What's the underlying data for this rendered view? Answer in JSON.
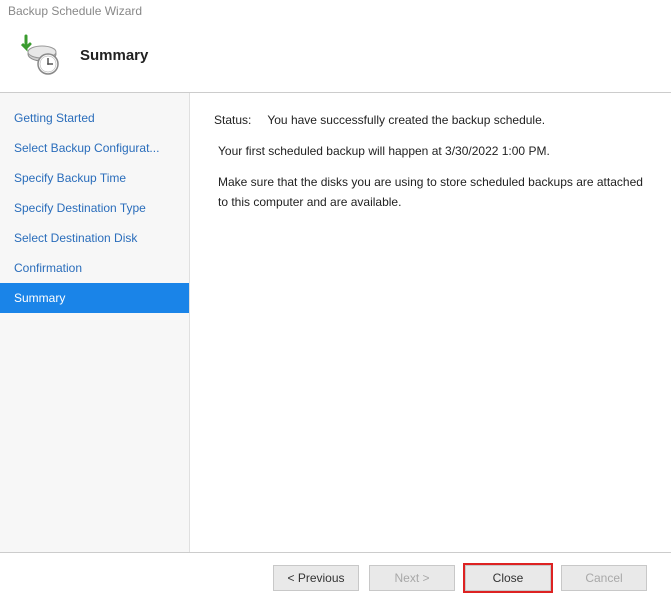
{
  "window": {
    "title": "Backup Schedule Wizard"
  },
  "header": {
    "title": "Summary"
  },
  "sidebar": {
    "items": [
      {
        "label": "Getting Started"
      },
      {
        "label": "Select Backup Configurat..."
      },
      {
        "label": "Specify Backup Time"
      },
      {
        "label": "Specify Destination Type"
      },
      {
        "label": "Select Destination Disk"
      },
      {
        "label": "Confirmation"
      },
      {
        "label": "Summary"
      }
    ],
    "active_index": 6
  },
  "content": {
    "status_label": "Status:",
    "status_text": "You have successfully created the backup schedule.",
    "line1": "Your first scheduled backup will happen at 3/30/2022 1:00 PM.",
    "line2": "Make sure that the disks you are using to store scheduled backups are attached to this computer and are available."
  },
  "footer": {
    "previous": "< Previous",
    "next": "Next >",
    "close": "Close",
    "cancel": "Cancel"
  }
}
